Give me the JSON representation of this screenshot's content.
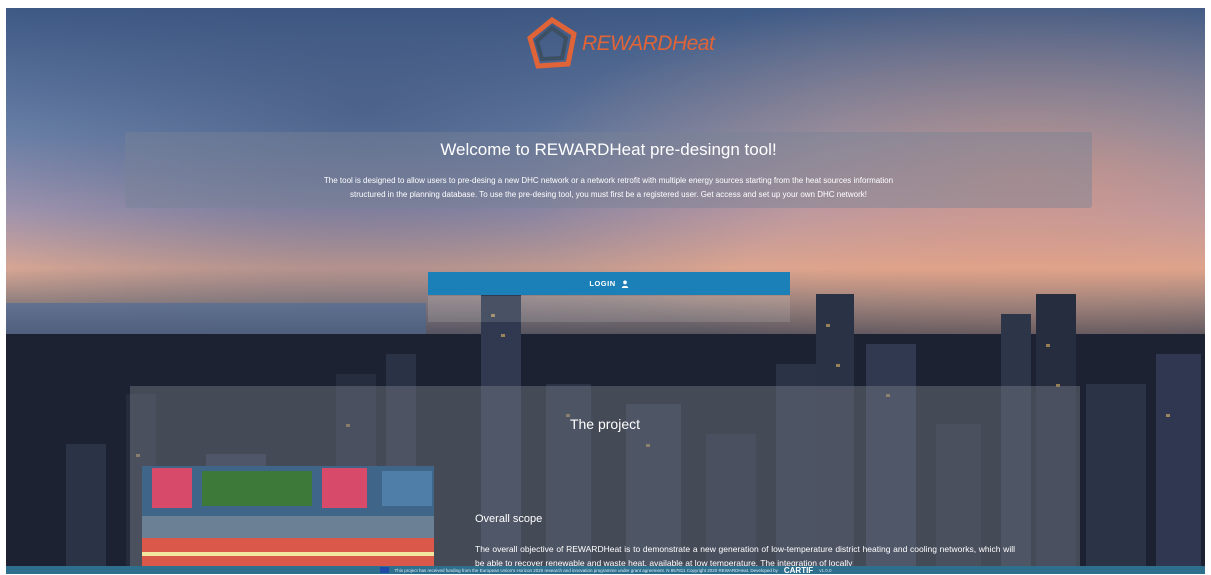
{
  "brand": {
    "name": "REWARDHeat"
  },
  "welcome": {
    "title": "Welcome to REWARDHeat pre-desingn tool!",
    "line1": "The tool is designed to allow users to pre-desing a new DHC network or a network retrofit with multiple energy sources starting from the heat sources information",
    "line2": "structured in the planning database. To use the pre-desing tool, you must first be a registered user. Get access and set up your own DHC network!"
  },
  "login": {
    "label": "LOGIN",
    "icon": "user-icon"
  },
  "project": {
    "title": "The project",
    "scope_title": "Overall scope",
    "scope_text": "The overall objective of REWARDHeat is to demonstrate a new generation of low-temperature district heating and cooling networks, which will be able to recover renewable and waste heat, available at low temperature. The integration of locally"
  },
  "footer": {
    "text": "This project has received funding from the European Union's Horizon 2020 research and innovation programme under grant agreement. N 857811 Copyright 2020 REWARDHeat. Developed by",
    "developer": "CARTIF",
    "version": "v1.0.0"
  }
}
